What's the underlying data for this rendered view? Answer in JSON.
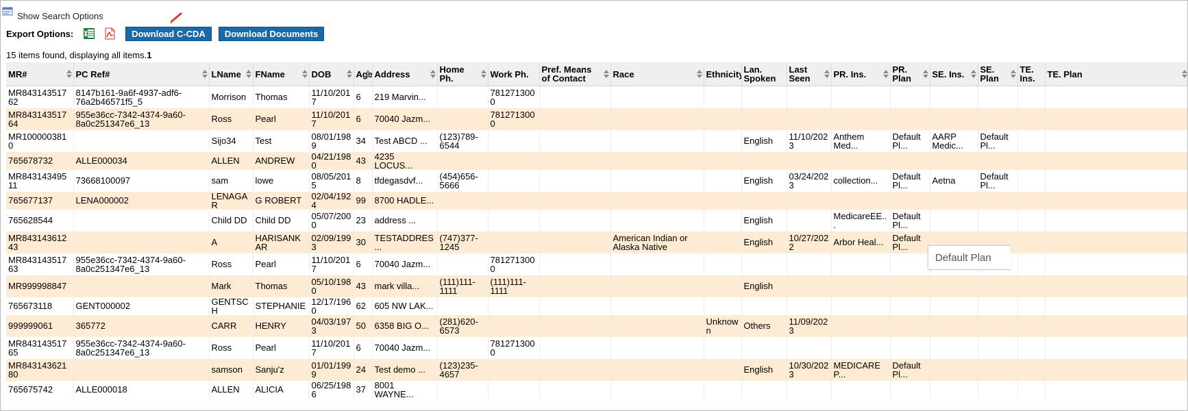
{
  "search": {
    "label": "Show Search Options"
  },
  "export": {
    "label": "Export Options:",
    "excel_icon": "excel-icon",
    "pdf_icon": "pdf-icon",
    "download_ccda": "Download C-CDA",
    "download_documents": "Download Documents"
  },
  "items_found": {
    "text": "15 items found, displaying all items.",
    "page": "1"
  },
  "columns": [
    "MR#",
    "PC Ref#",
    "LName",
    "FName",
    "DOB",
    "Age",
    "Address",
    "Home Ph.",
    "Work Ph.",
    "Pref. Means of Contact",
    "Race",
    "Ethnicity",
    "Lan. Spoken",
    "Last Seen",
    "PR. Ins.",
    "PR. Plan",
    "SE. Ins.",
    "SE. Plan",
    "TE. Ins.",
    "TE. Plan"
  ],
  "rows": [
    [
      "MR84314351762",
      "8147b161-9a6f-4937-adf6-76a2b46571f5_5",
      "Morrison",
      "Thomas",
      "11/10/2017",
      "6",
      "219 Marvin...",
      "",
      "7812713000",
      "",
      "",
      "",
      "",
      "",
      "",
      "",
      "",
      "",
      "",
      ""
    ],
    [
      "MR84314351764",
      "955e36cc-7342-4374-9a60-8a0c251347e6_13",
      "Ross",
      "Pearl",
      "11/10/2017",
      "6",
      "70040 Jazm...",
      "",
      "7812713000",
      "",
      "",
      "",
      "",
      "",
      "",
      "",
      "",
      "",
      "",
      ""
    ],
    [
      "MR1000003810",
      "",
      "Sijo34",
      "Test",
      "08/01/1989",
      "34",
      "Test ABCD ...",
      "(123)789-6544",
      "",
      "",
      "",
      "",
      "English",
      "11/10/2023",
      "Anthem Med...",
      "Default Pl...",
      "AARP Medic...",
      "Default Pl...",
      "",
      ""
    ],
    [
      "765678732",
      "ALLE000034",
      "ALLEN",
      "ANDREW",
      "04/21/1980",
      "43",
      "4235 LOCUS...",
      "",
      "",
      "",
      "",
      "",
      "",
      "",
      "",
      "",
      "",
      "",
      "",
      ""
    ],
    [
      "MR84314349511",
      "73668100097",
      "sam",
      "lowe",
      "08/05/2015",
      "8",
      "tfdegasdvf...",
      "(454)656-5666",
      "",
      "",
      "",
      "",
      "English",
      "03/24/2023",
      "collection...",
      "Default Pl...",
      "Aetna",
      "Default Pl...",
      "",
      ""
    ],
    [
      "765677137",
      "LENA000002",
      "LENAGAR",
      "G ROBERT",
      "02/04/1924",
      "99",
      "8700 HADLE...",
      "",
      "",
      "",
      "",
      "",
      "",
      "",
      "",
      "",
      "",
      "",
      "",
      ""
    ],
    [
      "765628544",
      "",
      "Child DD",
      "Child DD",
      "05/07/2000",
      "23",
      "address ...",
      "",
      "",
      "",
      "",
      "",
      "English",
      "",
      "MedicareEE...",
      "Default Pl...",
      "",
      "",
      "",
      ""
    ],
    [
      "MR84314361243",
      "",
      "A",
      "HARISANKAR",
      "02/09/1993",
      "30",
      "TESTADDRES...",
      "(747)377-1245",
      "",
      "",
      "American Indian or Alaska Native",
      "",
      "English",
      "10/27/2022",
      "Arbor Heal...",
      "Default Pl...",
      "",
      "",
      "",
      ""
    ],
    [
      "MR84314351763",
      "955e36cc-7342-4374-9a60-8a0c251347e6_13",
      "Ross",
      "Pearl",
      "11/10/2017",
      "6",
      "70040 Jazm...",
      "",
      "7812713000",
      "",
      "",
      "",
      "",
      "",
      "",
      "",
      "",
      "",
      "",
      ""
    ],
    [
      "MR999998847",
      "",
      "Mark",
      "Thomas",
      "05/10/1980",
      "43",
      "mark villa...",
      "(111)111-1111",
      "(111)111-1111",
      "",
      "",
      "",
      "English",
      "",
      "",
      "",
      "",
      "",
      "",
      ""
    ],
    [
      "765673118",
      "GENT000002",
      "GENTSCH",
      "STEPHANIE",
      "12/17/1960",
      "62",
      "605 NW LAK...",
      "",
      "",
      "",
      "",
      "",
      "",
      "",
      "",
      "",
      "",
      "",
      "",
      ""
    ],
    [
      "999999061",
      "365772",
      "CARR",
      "HENRY",
      "04/03/1973",
      "50",
      "6358 BIG O...",
      "(281)620-6573",
      "",
      "",
      "",
      "Unknown",
      "Others",
      "11/09/2023",
      "",
      "",
      "",
      "",
      "",
      ""
    ],
    [
      "MR84314351765",
      "955e36cc-7342-4374-9a60-8a0c251347e6_13",
      "Ross",
      "Pearl",
      "11/10/2017",
      "6",
      "70040 Jazm...",
      "",
      "7812713000",
      "",
      "",
      "",
      "",
      "",
      "",
      "",
      "",
      "",
      "",
      ""
    ],
    [
      "MR84314362180",
      "",
      "samson",
      "Sanju'z",
      "01/01/1999",
      "24",
      "Test demo ...",
      "(123)235-4657",
      "",
      "",
      "",
      "",
      "English",
      "10/30/2023",
      "MEDICARE P...",
      "Default Pl...",
      "",
      "",
      "",
      ""
    ],
    [
      "765675742",
      "ALLE000018",
      "ALLEN",
      "ALICIA",
      "06/25/1986",
      "37",
      "8001 WAYNE...",
      "",
      "",
      "",
      "",
      "",
      "",
      "",
      "",
      "",
      "",
      "",
      "",
      ""
    ]
  ],
  "tooltip": {
    "text": "Default Plan"
  },
  "colors": {
    "button": "#1a6aa8",
    "header_bg": "#efefef",
    "alt_row": "#fdebd3",
    "arrow": "#e0362c"
  }
}
